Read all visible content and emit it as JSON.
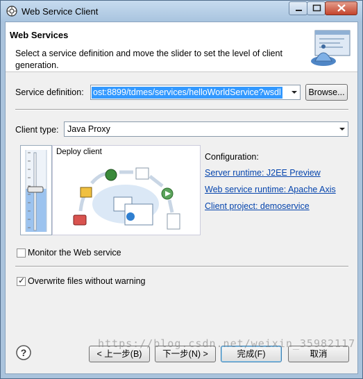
{
  "window": {
    "title": "Web Service Client"
  },
  "header": {
    "title": "Web Services",
    "description": "Select a service definition and move the slider to set the level of client generation."
  },
  "service_definition": {
    "label": "Service definition:",
    "value": "ost:8899/tdmes/services/helloWorldService?wsdl",
    "browse_label": "Browse..."
  },
  "client_type": {
    "label": "Client type:",
    "value": "Java Proxy"
  },
  "slider": {
    "level_label": "Deploy client",
    "level_fraction": 0.55
  },
  "configuration": {
    "heading": "Configuration:",
    "server_runtime": "Server runtime: J2EE Preview",
    "ws_runtime": "Web service runtime: Apache Axis",
    "client_project": "Client project: demoservice"
  },
  "options": {
    "monitor": {
      "label": "Monitor the Web service",
      "checked": false
    },
    "overwrite": {
      "label": "Overwrite files without warning",
      "checked": true
    }
  },
  "buttons": {
    "back": "< 上一步(B)",
    "next": "下一步(N) >",
    "finish": "完成(F)",
    "cancel": "取消"
  },
  "watermark": "https://blog.csdn.net/weixin_35982117"
}
